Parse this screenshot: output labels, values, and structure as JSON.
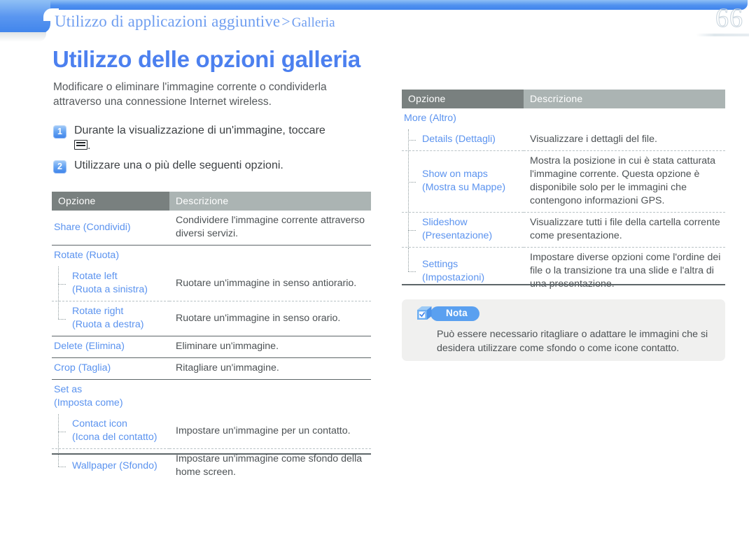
{
  "header": {
    "breadcrumb_main": "Utilizzo di applicazioni aggiuntive",
    "breadcrumb_separator": ">",
    "breadcrumb_sub": "Galleria",
    "page_number": "66",
    "accent_color": "#4c80ef",
    "bar_color": "#3f84ec"
  },
  "main": {
    "title": "Utilizzo delle opzioni galleria",
    "intro": "Modificare o eliminare l'immagine corrente o condividerla attraverso una connessione Internet wireless.",
    "steps": [
      {
        "number": "1",
        "text_before": "Durante la visualizzazione di un'immagine, toccare",
        "icon": "menu-icon",
        "text_after": "."
      },
      {
        "number": "2",
        "text_before": "Utilizzare una o più delle seguenti opzioni.",
        "icon": "",
        "text_after": ""
      }
    ]
  },
  "table_left": {
    "headers": {
      "option": "Opzione",
      "description": "Descrizione"
    },
    "rows": [
      {
        "option": "Share (Condividi)",
        "description": "Condividere l'immagine corrente attraverso diversi servizi.",
        "level": "top"
      },
      {
        "option": "Rotate (Ruota)",
        "description": "",
        "level": "group"
      },
      {
        "option_line1": "Rotate left",
        "option_line2": "(Ruota a sinistra)",
        "description": "Ruotare un'immagine in senso antiorario.",
        "level": "child"
      },
      {
        "option_line1": "Rotate right",
        "option_line2": "(Ruota a destra)",
        "description": "Ruotare un'immagine in senso orario.",
        "level": "child-last"
      },
      {
        "option": "Delete (Elimina)",
        "description": "Eliminare un'immagine.",
        "level": "top"
      },
      {
        "option": "Crop (Taglia)",
        "description": "Ritagliare un'immagine.",
        "level": "top"
      },
      {
        "option_line1": "Set as",
        "option_line2": "(Imposta come)",
        "description": "",
        "level": "group"
      },
      {
        "option_line1": "Contact icon",
        "option_line2": "(Icona del contatto)",
        "description": "Impostare un'immagine per un contatto.",
        "level": "child"
      },
      {
        "option_line1": "Wallpaper (Sfondo)",
        "option_line2": "",
        "description": "Impostare un'immagine come sfondo della home screen.",
        "level": "child-last"
      }
    ]
  },
  "table_right": {
    "headers": {
      "option": "Opzione",
      "description": "Descrizione"
    },
    "rows": [
      {
        "option_line1": "More (Altro)",
        "option_line2": "",
        "description": "",
        "level": "group"
      },
      {
        "option_line1": "Details (Dettagli)",
        "option_line2": "",
        "description": "Visualizzare i dettagli del file.",
        "level": "child"
      },
      {
        "option_line1": "Show on maps",
        "option_line2": "(Mostra su Mappe)",
        "description": "Mostra la posizione in cui è stata catturata l'immagine corrente. Questa opzione è disponibile solo per le immagini che contengono informazioni GPS.",
        "level": "child"
      },
      {
        "option_line1": "Slideshow",
        "option_line2": "(Presentazione)",
        "description": "Visualizzare tutti i file della cartella corrente come presentazione.",
        "level": "child"
      },
      {
        "option_line1": "Settings",
        "option_line2": "(Impostazioni)",
        "description": "Impostare diverse opzioni come l'ordine dei file o la transizione tra una slide e l'altra di una presentazione.",
        "level": "child-last"
      }
    ]
  },
  "note": {
    "label": "Nota",
    "icon": "note-check-box-icon",
    "text": "Può essere necessario ritagliare o adattare le immagini che si desidera utilizzare come sfondo o come icone contatto.",
    "pill_color": "#5aa0f0",
    "background_color": "#f0f0ef"
  }
}
